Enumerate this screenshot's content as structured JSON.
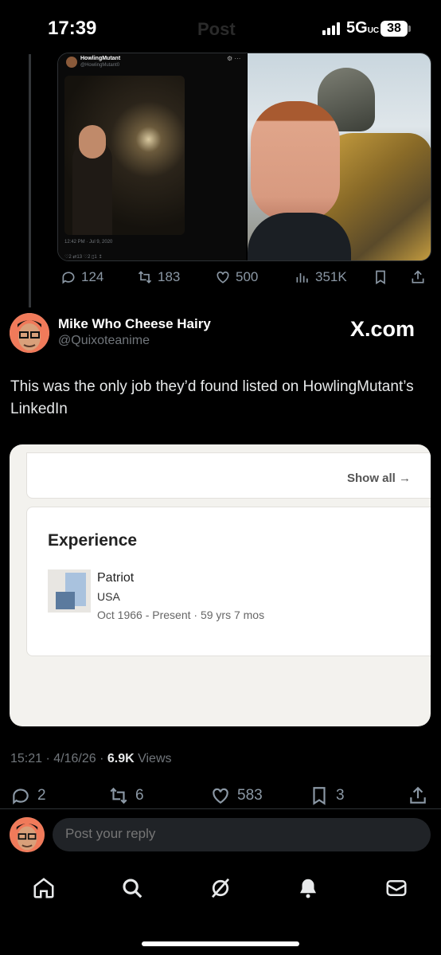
{
  "status": {
    "time": "17:39",
    "ghost_title": "Post",
    "network": "5G",
    "network_sub": "UC",
    "battery": "38"
  },
  "quoted": {
    "mini_name": "HowlingMutant",
    "mini_handle": "@HowlingMutant0",
    "mini_date": "12:42 PM · Jul 9, 2020",
    "mini_actions": "♡2    ⇄13    ♡2    ▯1    ↥",
    "stats": {
      "replies": "124",
      "reposts": "183",
      "likes": "500",
      "views": "351K"
    }
  },
  "author": {
    "name": "Mike Who Cheese Hairy",
    "handle": "@Quixoteanime"
  },
  "source_label": "X.com",
  "tweet_text": "This was the only job they’d found listed on HowlingMutant’s LinkedIn",
  "card": {
    "show_all": "Show all →",
    "section_title": "Experience",
    "role": "Patriot",
    "org": "USA",
    "dates": "Oct 1966 - Present · 59 yrs 7 mos"
  },
  "meta": {
    "time": "15:21 · 4/16/26 · ",
    "views_count": "6.9K",
    "views_label": " Views"
  },
  "actions": {
    "replies": "2",
    "reposts": "6",
    "likes": "583",
    "bookmarks": "3"
  },
  "reply": {
    "placeholder": "Post your reply"
  },
  "nav": [
    "home-icon",
    "search-icon",
    "grok-icon",
    "notifications-icon",
    "messages-icon"
  ]
}
